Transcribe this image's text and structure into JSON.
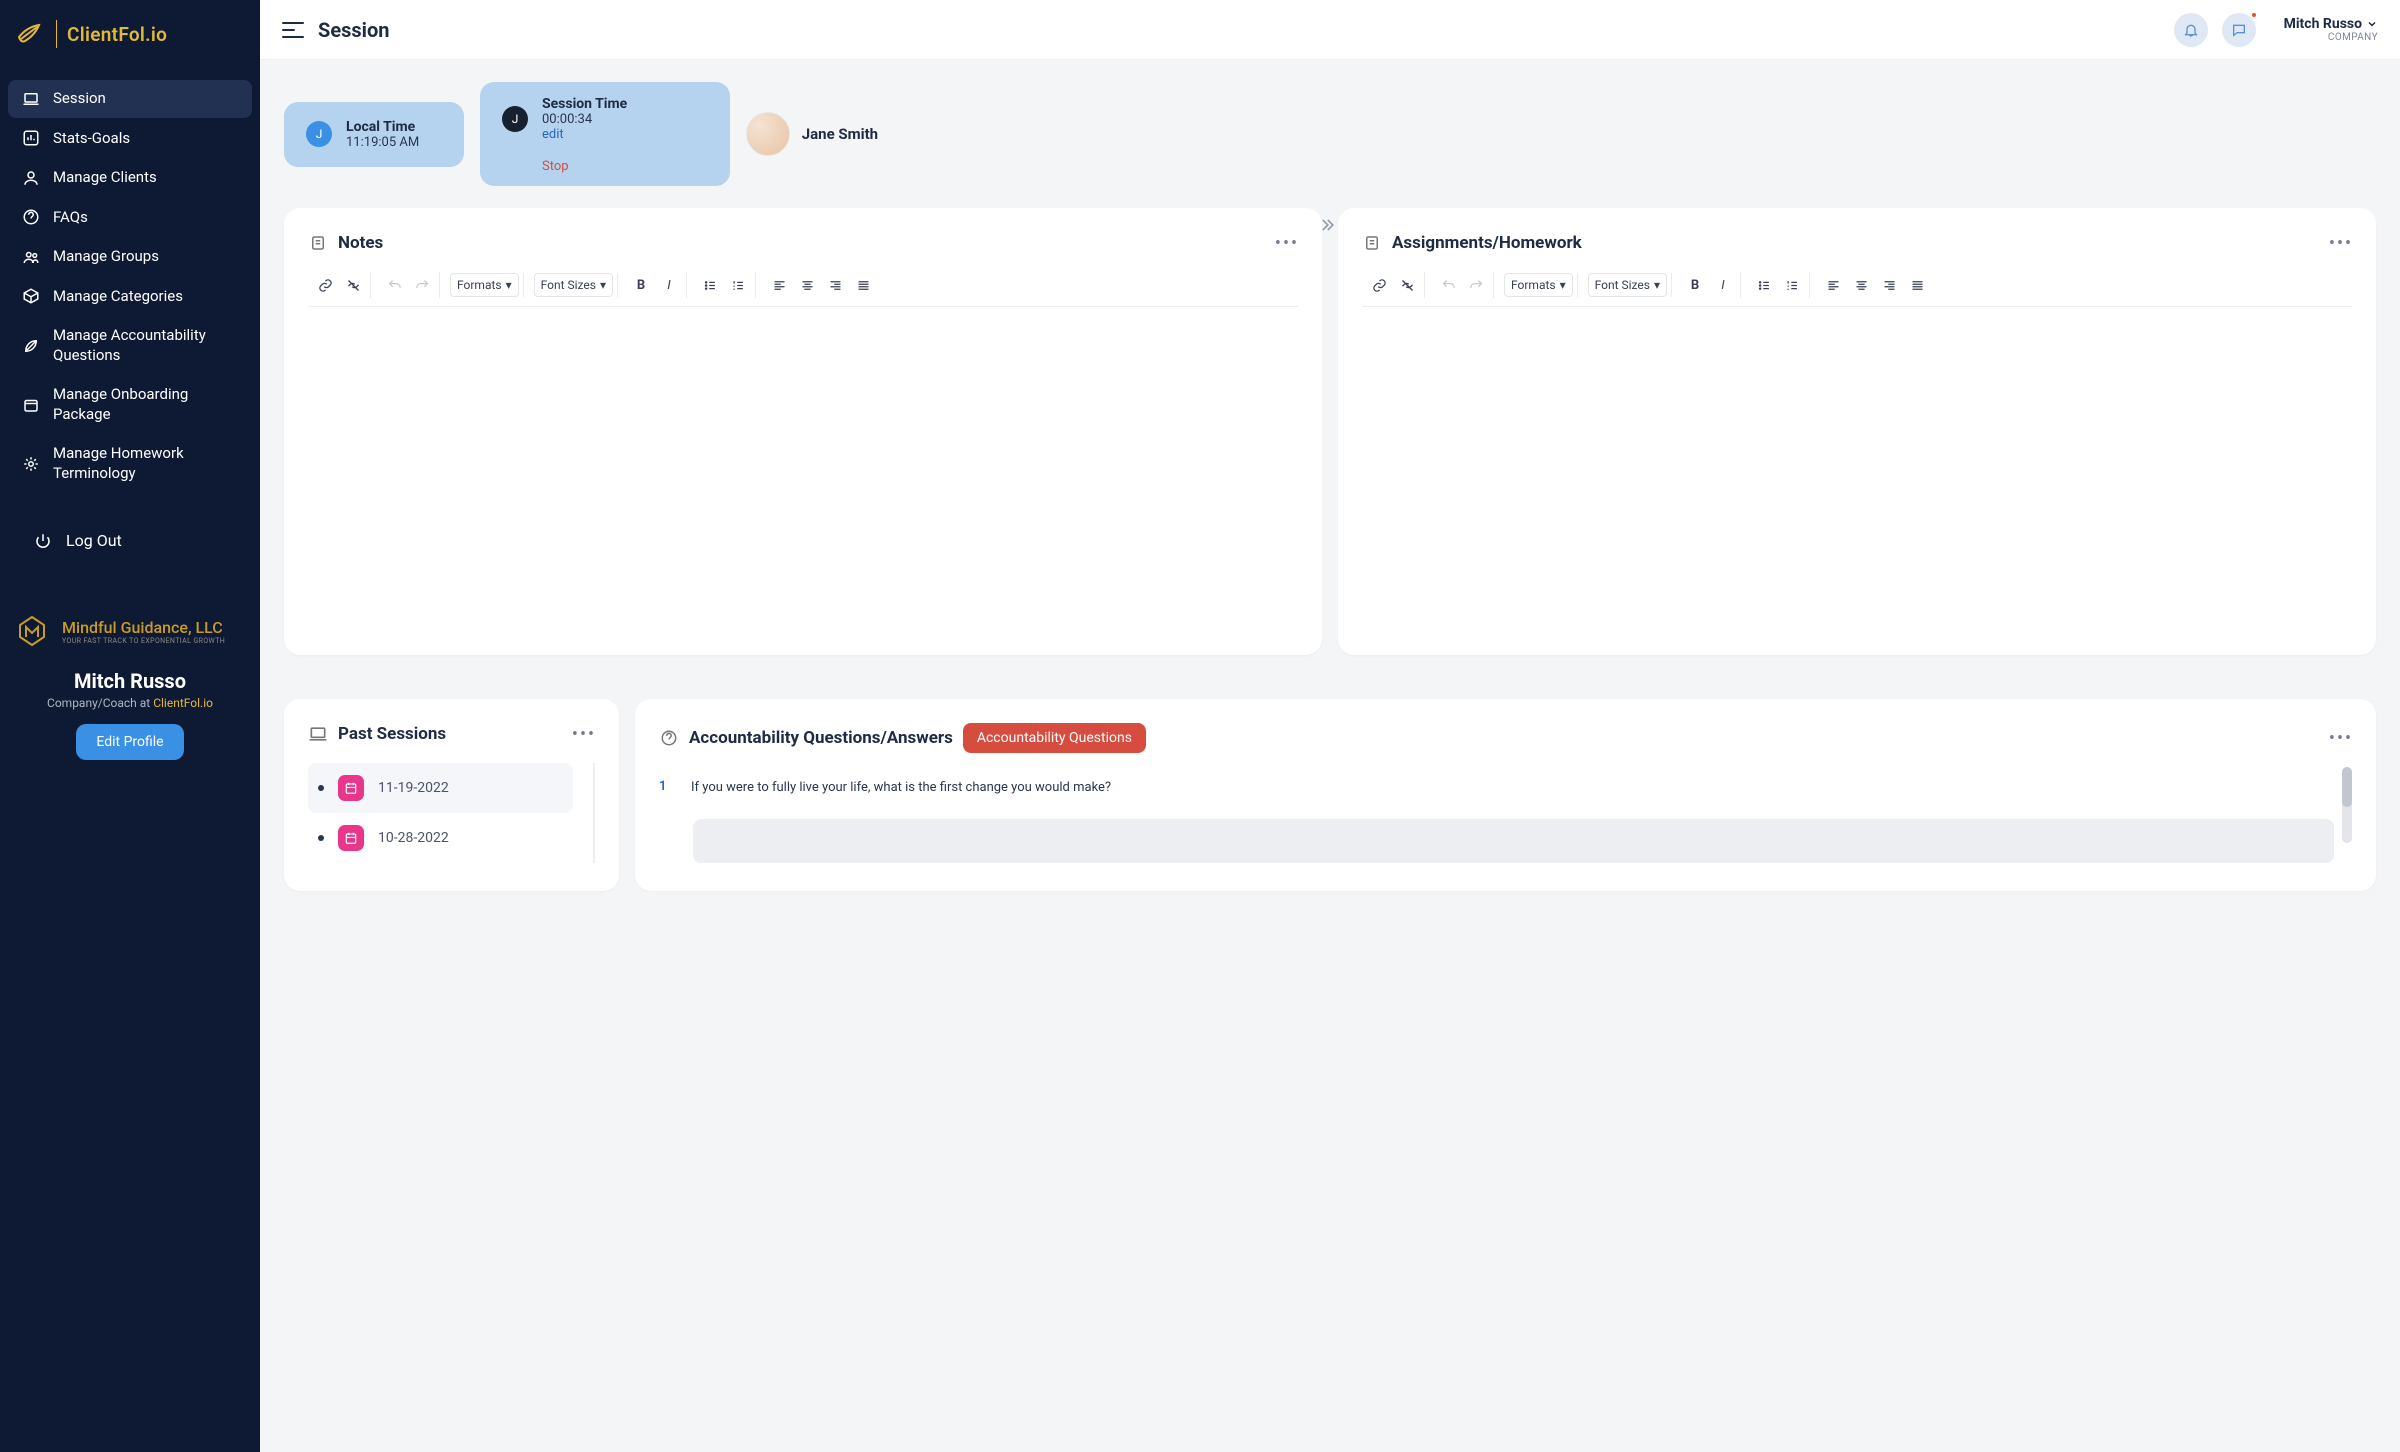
{
  "header": {
    "page_title": "Session",
    "profile_name": "Mitch Russo",
    "profile_company": "COMPANY"
  },
  "brand": {
    "logo_text": "ClientFol.io"
  },
  "sidebar": {
    "items": [
      {
        "label": "Session",
        "active": true
      },
      {
        "label": "Stats-Goals"
      },
      {
        "label": "Manage Clients"
      },
      {
        "label": "FAQs"
      },
      {
        "label": "Manage Groups"
      },
      {
        "label": "Manage Categories"
      },
      {
        "label": "Manage Accountability Questions"
      },
      {
        "label": "Manage Onboarding Package"
      },
      {
        "label": "Manage Homework Terminology"
      }
    ],
    "logout_label": "Log Out",
    "company_title": "Mindful Guidance, LLC",
    "company_sub": "YOUR FAST TRACK TO EXPONENTIAL GROWTH",
    "user_name": "Mitch Russo",
    "user_role_prefix": "Company/Coach at ",
    "user_role_brand": "ClientFol.io",
    "edit_profile": "Edit Profile"
  },
  "status": {
    "local_time_label": "Local Time",
    "local_time_value": "11:19:05 AM",
    "session_time_label": "Session Time",
    "session_time_value": "00:00:34",
    "edit_label": "edit",
    "stop_label": "Stop",
    "client_name": "Jane Smith"
  },
  "panels": {
    "notes_title": "Notes",
    "assignments_title": "Assignments/Homework",
    "formats_label": "Formats",
    "fontsizes_label": "Font Sizes",
    "past_title": "Past Sessions",
    "past_items": [
      {
        "date": "11-19-2022"
      },
      {
        "date": "10-28-2022"
      }
    ],
    "qa_title": "Accountability Questions/Answers",
    "qa_chip": "Accountability Questions",
    "q1_num": "1",
    "q1_text": "If you were to fully live your life, what is the first change you would make?"
  }
}
